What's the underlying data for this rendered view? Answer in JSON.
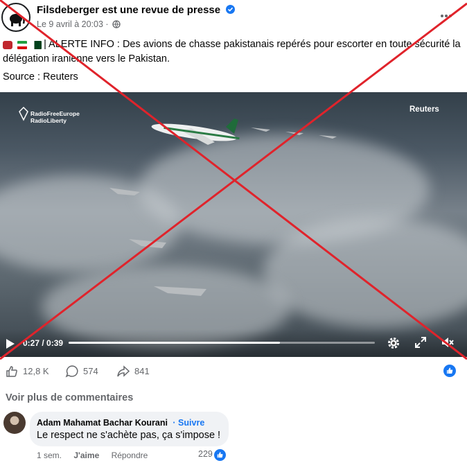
{
  "post": {
    "page_name": "Filsdeberger est une revue de presse",
    "date": "Le 9 avril à 20:03 ·",
    "text_line1": "| ALERTE INFO : Des avions de chasse pakistanais repérés pour escorter en toute sécurité la",
    "text_line2": "délégation iranienne vers le Pakistan.",
    "source": "Source : Reuters",
    "flags": [
      "iran",
      "pakistan"
    ],
    "icons": [
      "verified-icon",
      "globe-icon",
      "more-icon"
    ]
  },
  "video": {
    "logo_line1": "RadioFreeEurope",
    "logo_line2": "RadioLiberty",
    "watermark": "Reuters",
    "time": "0:27 / 0:39",
    "progress": 0.69,
    "icons": [
      "play-icon",
      "settings-icon",
      "fullscreen-icon",
      "mute-icon"
    ]
  },
  "stats": {
    "likes": "12,8 K",
    "comments": "574",
    "shares": "841"
  },
  "comments": {
    "see_more": "Voir plus de commentaires",
    "items": [
      {
        "author": "Adam Mahamat Bachar Kourani",
        "follow": "· Suivre",
        "text": "Le respect ne s'achète pas, ça s'impose !",
        "age": "1 sem.",
        "like_label": "J'aime",
        "reply_label": "Répondre",
        "like_count": "229"
      }
    ]
  },
  "overlay": {
    "cross_color": "#e0232b"
  }
}
